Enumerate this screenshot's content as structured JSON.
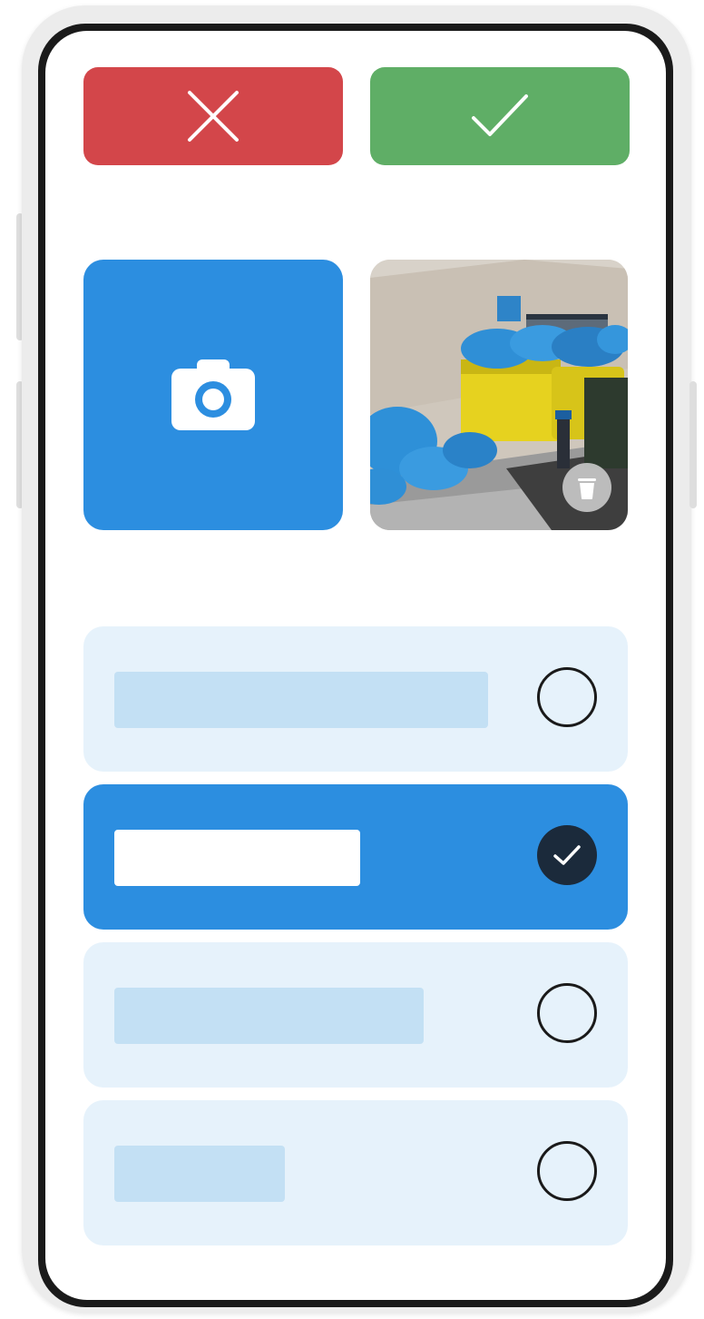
{
  "colors": {
    "cancel": "#d3464a",
    "confirm": "#5fae66",
    "primary": "#2c8ee0",
    "option_bg": "#e6f2fb",
    "option_placeholder": "#c3e0f4",
    "selected_placeholder": "#ffffff",
    "checkmark_bg": "#1b2a3b"
  },
  "actions": {
    "cancel_icon": "close-icon",
    "confirm_icon": "check-icon"
  },
  "photos": {
    "camera_icon": "camera-icon",
    "thumbnail_icon": "photo-thumbnail",
    "delete_icon": "trash-icon"
  },
  "options": [
    {
      "selected": false,
      "placeholder_fraction": 0.7
    },
    {
      "selected": true,
      "placeholder_fraction": 0.46
    },
    {
      "selected": false,
      "placeholder_fraction": 0.58
    },
    {
      "selected": false,
      "placeholder_fraction": 0.32
    }
  ]
}
